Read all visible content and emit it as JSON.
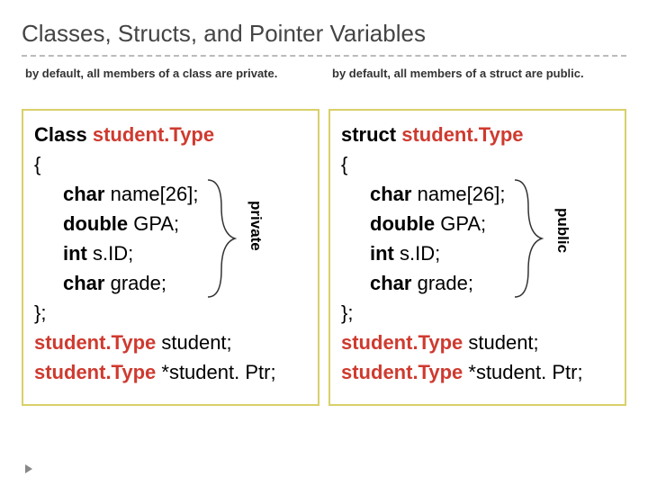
{
  "title": "Classes, Structs, and Pointer Variables",
  "left": {
    "caption": "by default, all members of a class are private.",
    "keyword": "Class",
    "typename": "student.Type",
    "open": "{",
    "members": {
      "l1a": "char",
      "l1b": " name[26];",
      "l2a": "double",
      "l2b": " GPA;",
      "l3a": "int",
      "l3b": " s.ID;",
      "l4a": "char",
      "l4b": " grade;"
    },
    "close": "};",
    "decl1_type": "student.Type",
    "decl1_rest": " student;",
    "decl2_type": "student.Type",
    "decl2_rest": " *student. Ptr;",
    "side_label": "private"
  },
  "right": {
    "caption": "by default, all members of a struct are public.",
    "keyword": "struct",
    "typename": "student.Type",
    "open": "{",
    "members": {
      "l1a": "char",
      "l1b": " name[26];",
      "l2a": "double",
      "l2b": " GPA;",
      "l3a": "int",
      "l3b": " s.ID;",
      "l4a": "char",
      "l4b": " grade;"
    },
    "close": "};",
    "decl1_type": "student.Type",
    "decl1_rest": " student;",
    "decl2_type": "student.Type",
    "decl2_rest": " *student. Ptr;",
    "side_label": "public"
  }
}
